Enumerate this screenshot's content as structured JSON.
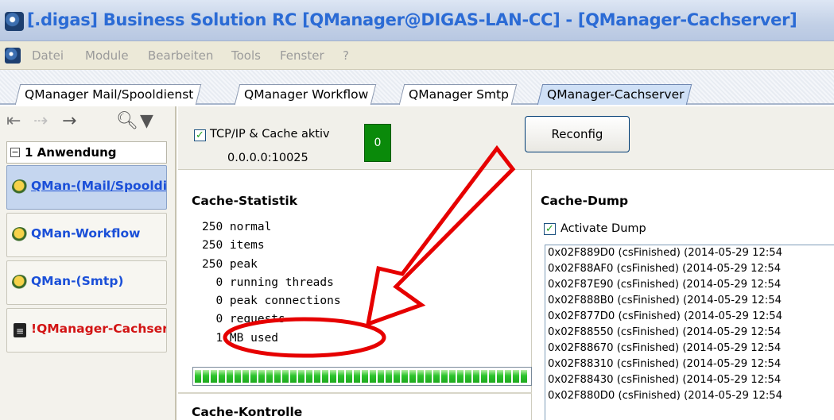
{
  "window": {
    "title": "[.digas] Business Solution RC [QManager@DIGAS-LAN-CC] - [QManager-Cachserver]"
  },
  "menu": {
    "items": [
      "Datei",
      "Module",
      "Bearbeiten",
      "Tools",
      "Fenster",
      "?"
    ]
  },
  "tabs": [
    {
      "label": "QManager Mail/Spooldienst",
      "active": false
    },
    {
      "label": "QManager Workflow",
      "active": false
    },
    {
      "label": "QManager Smtp",
      "active": false
    },
    {
      "label": "QManager-Cachserver",
      "active": true
    }
  ],
  "sidebar": {
    "group": "1 Anwendung",
    "items": [
      {
        "label": "QMan-(Mail/Spooldienst)",
        "icon": "bird-icon",
        "selected": true
      },
      {
        "label": "QMan-Workflow",
        "icon": "bird-icon",
        "selected": false
      },
      {
        "label": "QMan-(Smtp)",
        "icon": "bird-icon",
        "selected": false
      },
      {
        "label": "!QManager-Cachserver",
        "icon": "document-icon",
        "selected": false,
        "color": "#d21414"
      }
    ]
  },
  "top": {
    "tcp_label": "TCP/IP & Cache aktiv",
    "tcp_checked": true,
    "address": "0.0.0.0:10025",
    "status_value": "0",
    "status_color": "#0a8a0a",
    "reconfig_label": "Reconfig"
  },
  "stats": {
    "title": "Cache-Statistik",
    "lines": [
      "250 normal",
      "250 items",
      "250 peak",
      "  0 running threads",
      "  0 peak connections",
      "  0 requests",
      "  1 MB used"
    ],
    "progress_fraction": 1.0
  },
  "kontrolle": {
    "title": "Cache-Kontrolle"
  },
  "dump": {
    "title": "Cache-Dump",
    "activate_label": "Activate Dump",
    "activate_checked": true,
    "rows": [
      "0x02F889D0 (csFinished) (2014-05-29 12:54",
      "0x02F88AF0 (csFinished) (2014-05-29 12:54",
      "0x02F87E90 (csFinished) (2014-05-29 12:54",
      "0x02F888B0 (csFinished) (2014-05-29 12:54",
      "0x02F877D0 (csFinished) (2014-05-29 12:54",
      "0x02F88550 (csFinished) (2014-05-29 12:54",
      "0x02F88670 (csFinished) (2014-05-29 12:54",
      "0x02F88310 (csFinished) (2014-05-29 12:54",
      "0x02F88430 (csFinished) (2014-05-29 12:54",
      "0x02F880D0 (csFinished) (2014-05-29 12:54"
    ]
  },
  "colors": {
    "annotation_red": "#e60000",
    "accent_blue": "#1a4fd8"
  }
}
